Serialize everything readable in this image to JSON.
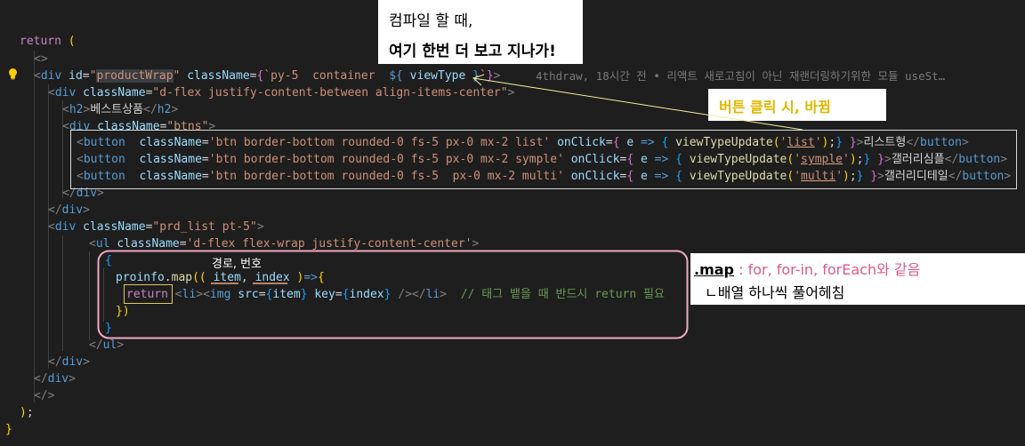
{
  "annotations": {
    "top_line1": "컴파일 할 때,",
    "top_line2": "여기 한번 더 보고 지나가!",
    "button_note": "버튼 클릭 시, 바뀜",
    "map_label": ".map",
    "map_desc": " : for, for-in, forEach와 같음",
    "map_desc2": "ㄴ배열 하나씩 풀어헤침",
    "params_note": "경로,  번호"
  },
  "codelens": "4thdraw, 18시간 전 • 리액트 새로고침이 아닌 재랜더링하기위한 모듈 useSt…",
  "code": {
    "return_kw": "return",
    "div_id_val": "productWrap",
    "class_template": "py-5  container  ",
    "template_expr": "${ viewType }",
    "d_flex_class": "d-flex justify-content-between align-items-center",
    "h2_text": "베스트상품",
    "btns_class": "btns",
    "btn1_class": "btn border-bottom rounded-0 fs-5 px-0 mx-2 list",
    "btn1_arg": "list",
    "btn1_text": "리스트형",
    "btn2_class": "btn border-bottom rounded-0 fs-5 px-0 mx-2 symple",
    "btn2_arg": "symple",
    "btn2_text": "갤러리심플",
    "btn3_class": "btn border-bottom rounded-0 fs-5  px-0 mx-2 multi",
    "btn3_arg": "multi",
    "btn3_text": "갤러리디테일",
    "prd_class": "prd_list pt-5",
    "ul_class": "d-flex flex-wrap justify-content-center",
    "map_obj": "proinfo",
    "map_fn": "map",
    "param_item": "item",
    "param_index": "index",
    "comment": "// 태그 뱉을 때 반드시 return 필요"
  }
}
